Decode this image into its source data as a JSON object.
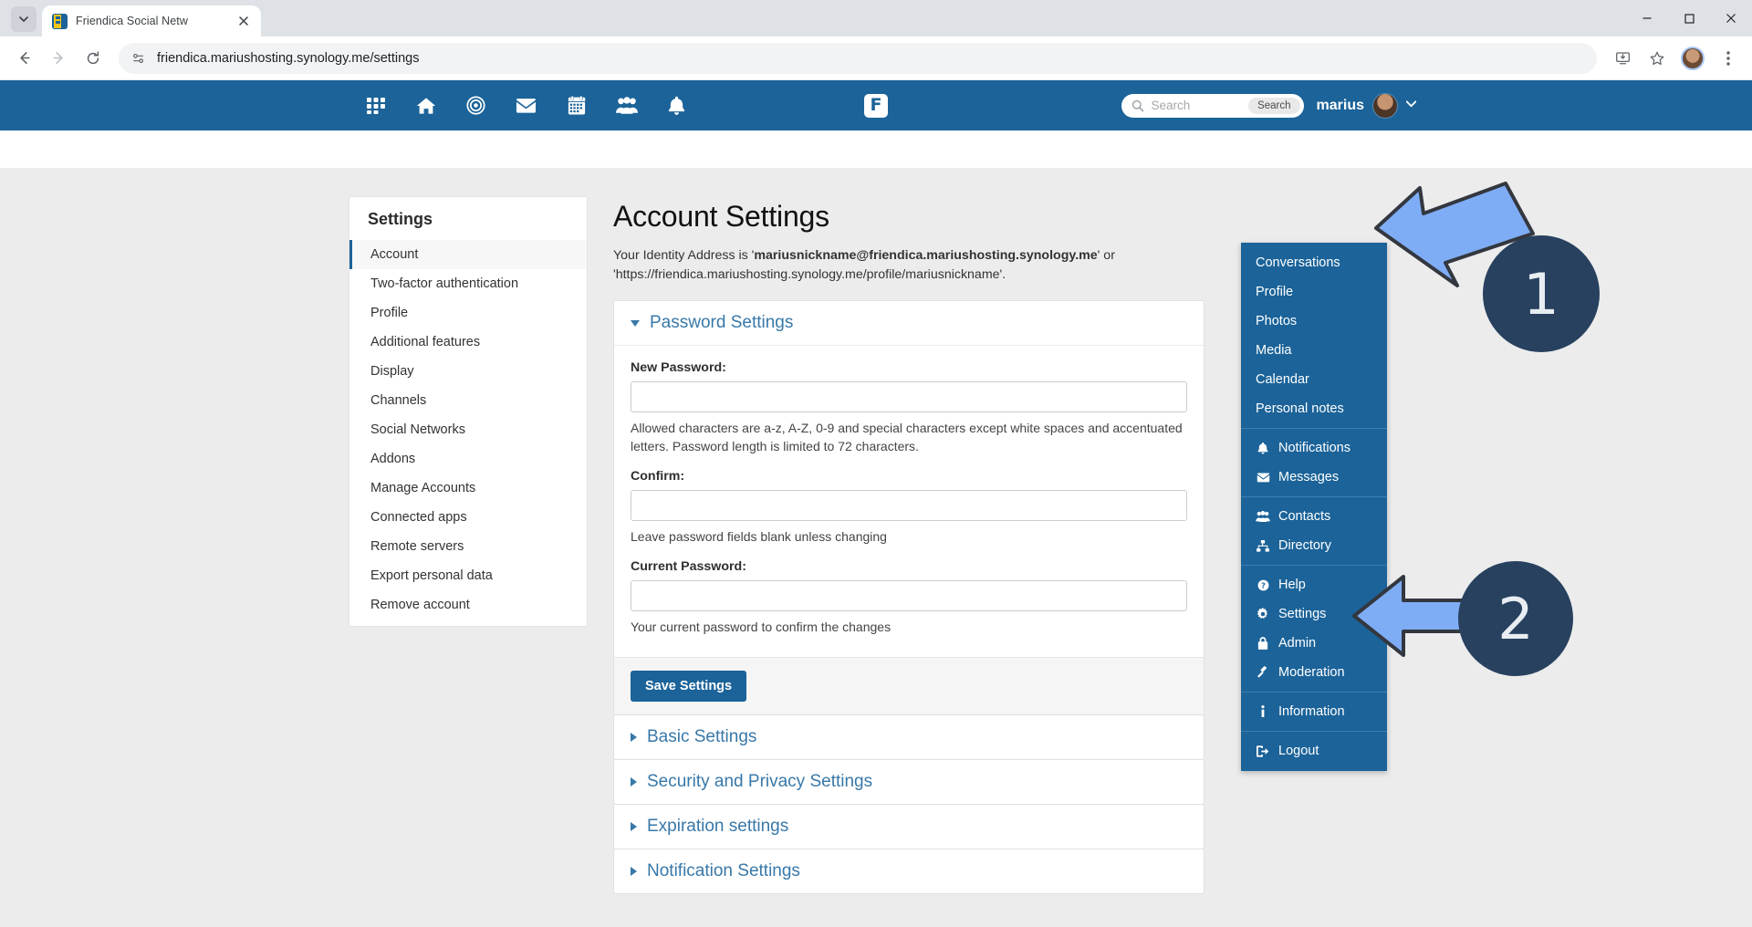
{
  "browser": {
    "tab": {
      "title": "Friendica Social Netw",
      "favicon": "friendica-favicon",
      "close": "×"
    },
    "tab_list_icon": "chevron-down-icon",
    "nav": {
      "back": "back-arrow-icon",
      "forward": "forward-arrow-icon",
      "reload": "reload-icon",
      "site_info": "site-settings-icon"
    },
    "url": "friendica.mariushosting.synology.me/settings",
    "right_icons": {
      "install": "install-app-icon",
      "bookmark": "star-icon",
      "profile": "chrome-profile-avatar",
      "menu": "three-dot-menu-icon"
    },
    "window": {
      "minimize": "–",
      "maximize": "□",
      "close": "✕"
    }
  },
  "navbar": {
    "icons": [
      {
        "name": "apps-grid-icon",
        "label": "Apps"
      },
      {
        "name": "home-icon",
        "label": "Home"
      },
      {
        "name": "network-icon",
        "label": "Network"
      },
      {
        "name": "mail-icon",
        "label": "Messages"
      },
      {
        "name": "calendar-icon",
        "label": "Calendar"
      },
      {
        "name": "contacts-icon",
        "label": "Contacts"
      },
      {
        "name": "bell-icon",
        "label": "Notifications"
      }
    ],
    "brand": "F",
    "search": {
      "placeholder": "Search",
      "value": "",
      "button_label": "Search",
      "icon": "search-icon"
    },
    "user": {
      "name": "marius",
      "avatar": "user-avatar",
      "caret": "chevron-down-icon"
    }
  },
  "dropdown": {
    "groups": [
      {
        "items": [
          {
            "label": "Conversations",
            "icon": null
          },
          {
            "label": "Profile",
            "icon": null
          },
          {
            "label": "Photos",
            "icon": null
          },
          {
            "label": "Media",
            "icon": null
          },
          {
            "label": "Calendar",
            "icon": null
          },
          {
            "label": "Personal notes",
            "icon": null
          }
        ]
      },
      {
        "items": [
          {
            "label": "Notifications",
            "icon": "bell-icon"
          },
          {
            "label": "Messages",
            "icon": "envelope-icon"
          }
        ]
      },
      {
        "items": [
          {
            "label": "Contacts",
            "icon": "contacts-icon"
          },
          {
            "label": "Directory",
            "icon": "sitemap-icon"
          }
        ]
      },
      {
        "items": [
          {
            "label": "Help",
            "icon": "question-circle-icon"
          },
          {
            "label": "Settings",
            "icon": "gear-icon"
          },
          {
            "label": "Admin",
            "icon": "lock-icon"
          },
          {
            "label": "Moderation",
            "icon": "gavel-icon"
          }
        ]
      },
      {
        "items": [
          {
            "label": "Information",
            "icon": "info-icon"
          }
        ]
      },
      {
        "items": [
          {
            "label": "Logout",
            "icon": "sign-out-icon"
          }
        ]
      }
    ]
  },
  "sidebar": {
    "title": "Settings",
    "items": [
      {
        "label": "Account",
        "active": true
      },
      {
        "label": "Two-factor authentication",
        "active": false
      },
      {
        "label": "Profile",
        "active": false
      },
      {
        "label": "Additional features",
        "active": false
      },
      {
        "label": "Display",
        "active": false
      },
      {
        "label": "Channels",
        "active": false
      },
      {
        "label": "Social Networks",
        "active": false
      },
      {
        "label": "Addons",
        "active": false
      },
      {
        "label": "Manage Accounts",
        "active": false
      },
      {
        "label": "Connected apps",
        "active": false
      },
      {
        "label": "Remote servers",
        "active": false
      },
      {
        "label": "Export personal data",
        "active": false
      },
      {
        "label": "Remove account",
        "active": false
      }
    ]
  },
  "main": {
    "title": "Account Settings",
    "identity_prefix": "Your Identity Address is '",
    "identity_address": "mariusnickname@friendica.mariushosting.synology.me",
    "identity_middle": "' or '",
    "identity_url": "https://friendica.mariushosting.synology.me/profile/mariusnickname",
    "identity_suffix": "'.",
    "password_panel": {
      "title": "Password Settings",
      "expanded": true,
      "new_password": {
        "label": "New Password:",
        "value": "",
        "help": "Allowed characters are a-z, A-Z, 0-9 and special characters except white spaces and accentuated letters. Password length is limited to 72 characters."
      },
      "confirm": {
        "label": "Confirm:",
        "value": "",
        "help": "Leave password fields blank unless changing"
      },
      "current_password": {
        "label": "Current Password:",
        "value": "",
        "help": "Your current password to confirm the changes"
      },
      "save_label": "Save Settings"
    },
    "collapsed_panels": [
      {
        "title": "Basic Settings"
      },
      {
        "title": "Security and Privacy Settings"
      },
      {
        "title": "Expiration settings"
      },
      {
        "title": "Notification Settings"
      }
    ]
  },
  "annotations": {
    "steps": [
      {
        "number": "1",
        "points_to": "user-avatar"
      },
      {
        "number": "2",
        "points_to": "dropdown-item-settings"
      }
    ],
    "arrow_color": "#7FADF5",
    "badge_color": "#27415F"
  }
}
